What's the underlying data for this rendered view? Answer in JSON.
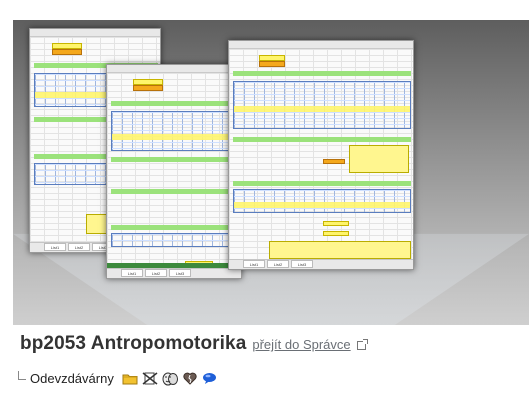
{
  "item": {
    "title": "bp2053 Antropomotorika",
    "link_label": "přejít do Správce",
    "subtitle": "Odevzdávárny"
  },
  "icons": [
    "folder-icon",
    "no-entry-icon",
    "masks-icon",
    "broken-heart-icon",
    "chat-bubble-icon"
  ],
  "colors": {
    "title": "#333333",
    "link": "#6a6f75",
    "spreadsheet_green": "#9be27b",
    "spreadsheet_yellow": "#fff56b",
    "spreadsheet_orange": "#f4a81c"
  },
  "preview": {
    "sheet_tabs": [
      "List1",
      "List2",
      "List3"
    ]
  }
}
